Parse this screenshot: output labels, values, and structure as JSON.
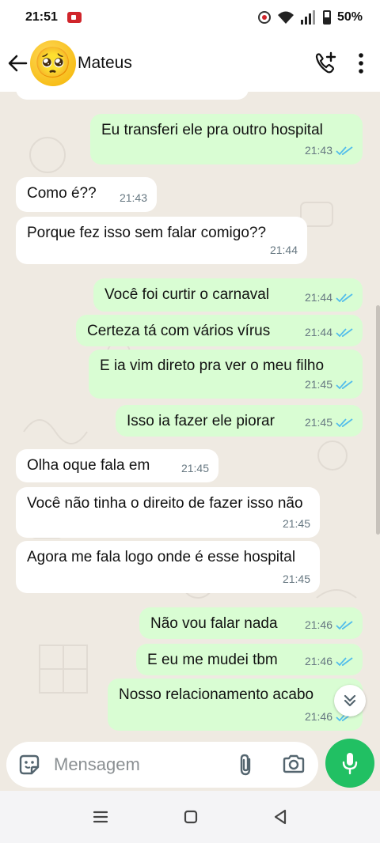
{
  "status_bar": {
    "time": "21:51",
    "battery": "50%"
  },
  "header": {
    "contact_name": "Mateus",
    "avatar_emoji": "🥺"
  },
  "messages": [
    {
      "dir": "out",
      "text": "Eu transferi ele pra outro hospital",
      "time": "21:43"
    },
    {
      "dir": "in",
      "text": "Como é??",
      "time": "21:43"
    },
    {
      "dir": "in",
      "text": "Porque fez isso sem falar comigo??",
      "time": "21:44"
    },
    {
      "dir": "out",
      "text": "Você foi curtir o carnaval",
      "time": "21:44"
    },
    {
      "dir": "out",
      "text": "Certeza tá com vários vírus",
      "time": "21:44"
    },
    {
      "dir": "out",
      "text": "E ia vim direto pra ver o meu filho",
      "time": "21:45"
    },
    {
      "dir": "out",
      "text": "Isso ia fazer ele piorar",
      "time": "21:45"
    },
    {
      "dir": "in",
      "text": "Olha oque fala em",
      "time": "21:45"
    },
    {
      "dir": "in",
      "text": "Você não tinha o direito de fazer isso não",
      "time": "21:45"
    },
    {
      "dir": "in",
      "text": "Agora me fala logo onde é esse hospital",
      "time": "21:45"
    },
    {
      "dir": "out",
      "text": "Não vou falar nada",
      "time": "21:46"
    },
    {
      "dir": "out",
      "text": "E eu me mudei tbm",
      "time": "21:46"
    },
    {
      "dir": "out",
      "text": "Nosso relacionamento acabo",
      "time": "21:46"
    }
  ],
  "input": {
    "placeholder": "Mensagem"
  },
  "colors": {
    "outgoing_bubble": "#d9fdd3",
    "incoming_bubble": "#ffffff",
    "chat_bg": "#efeae2",
    "mic_button": "#21c063",
    "read_ticks": "#53bdeb"
  }
}
